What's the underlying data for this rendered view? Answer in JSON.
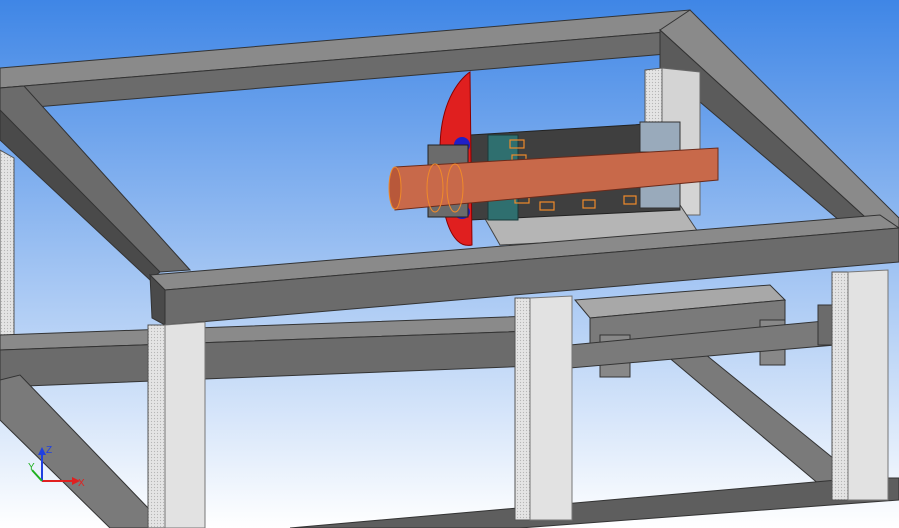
{
  "viewport": {
    "background_top": "#3f86e6",
    "background_bottom": "#ffffff",
    "frame_color": "#6b6b6b",
    "frame_dark": "#454545",
    "frame_light": "#8a8a8a",
    "post_color": "#d9d9d9",
    "shaft_color": "#c8694a",
    "disc_color": "#e01f1f",
    "bearing_color": "#2f6f6f",
    "hub_color": "#1f1fc8"
  },
  "axis_triad": {
    "x_label": "X",
    "y_label": "Y",
    "z_label": "Z",
    "x_color": "#e02020",
    "y_color": "#20b020",
    "z_color": "#2040e0"
  }
}
